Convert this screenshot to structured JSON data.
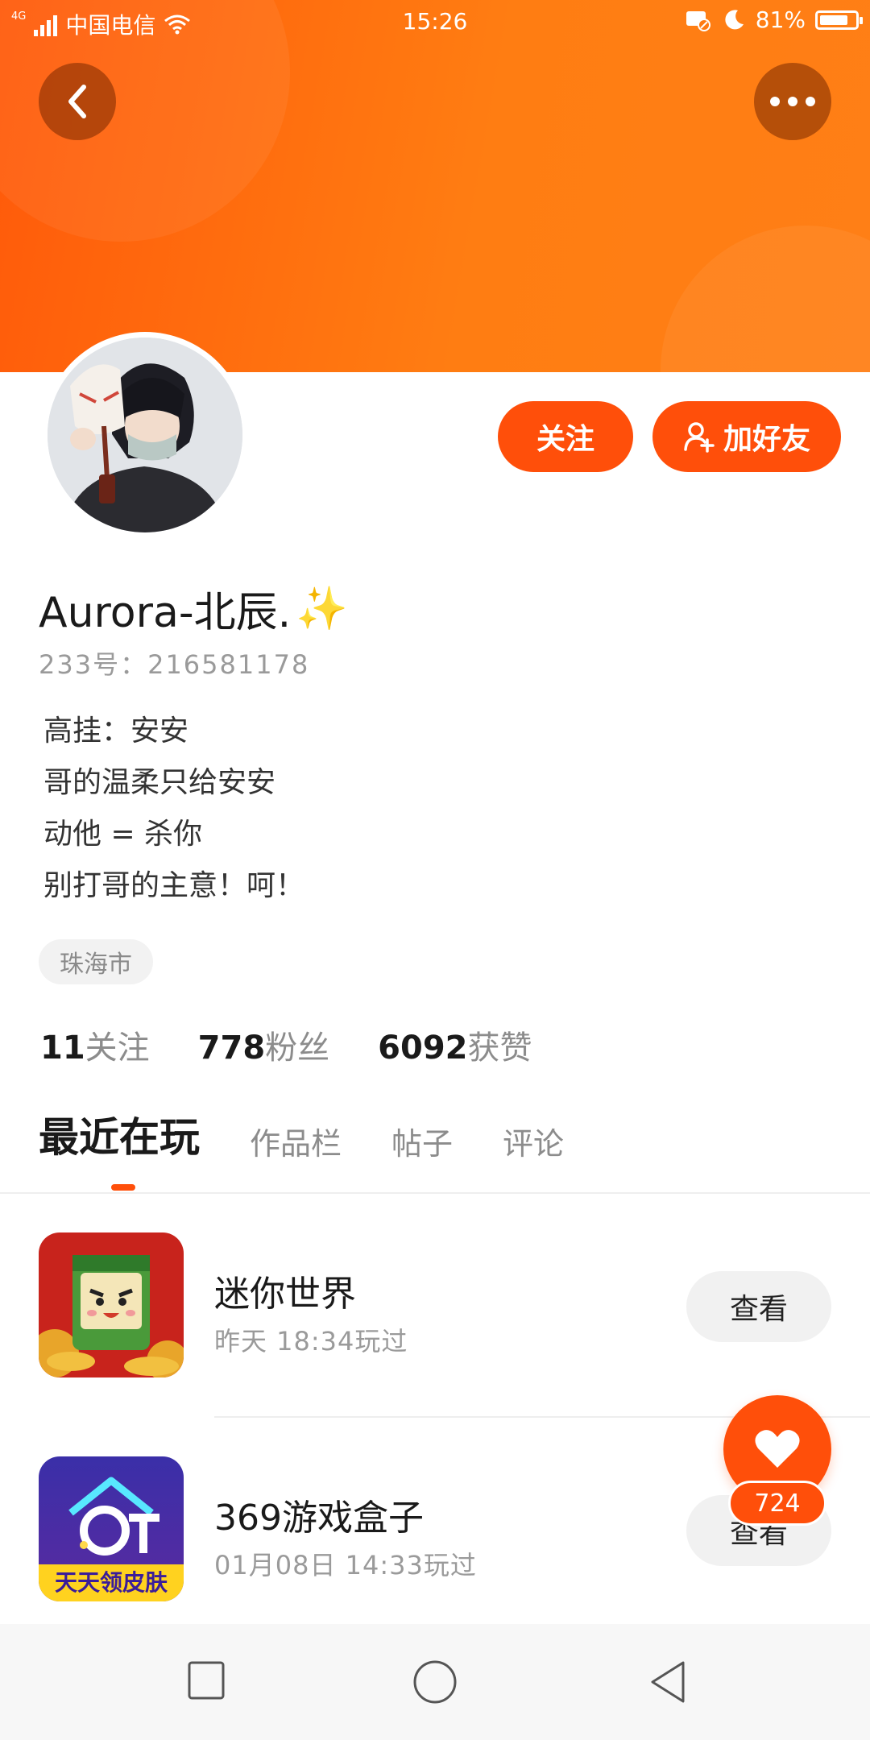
{
  "status_bar": {
    "network": "4G",
    "carrier": "中国电信",
    "time": "15:26",
    "battery": "81%",
    "battery_level": 0.81
  },
  "header": {
    "back_icon": "chevron-left-icon",
    "more_icon": "more-dots-icon"
  },
  "profile": {
    "follow_label": "关注",
    "add_friend_label": "加好友",
    "name": "Aurora-北辰.",
    "name_emoji": "✨",
    "uid": "233号：216581178",
    "bio": [
      "高挂：安安",
      "哥的温柔只给安安",
      "动他 = 杀你",
      "别打哥的主意！呵！"
    ],
    "location": "珠海市"
  },
  "stats": [
    {
      "num": "11",
      "label": "关注"
    },
    {
      "num": "778",
      "label": "粉丝"
    },
    {
      "num": "6092",
      "label": "获赞"
    }
  ],
  "tabs": [
    "最近在玩",
    "作品栏",
    "帖子",
    "评论"
  ],
  "games": [
    {
      "title": "迷你世界",
      "time": "昨天 18:34玩过",
      "button": "查看"
    },
    {
      "title": "369游戏盒子",
      "time": "01月08日 14:33玩过",
      "button": "查看",
      "icon_text": "天天领皮肤"
    }
  ],
  "likes": {
    "count": "724"
  },
  "colors": {
    "accent": "#ff4f0a",
    "header_start": "#ff5a0a",
    "header_end": "#ff7f16"
  }
}
